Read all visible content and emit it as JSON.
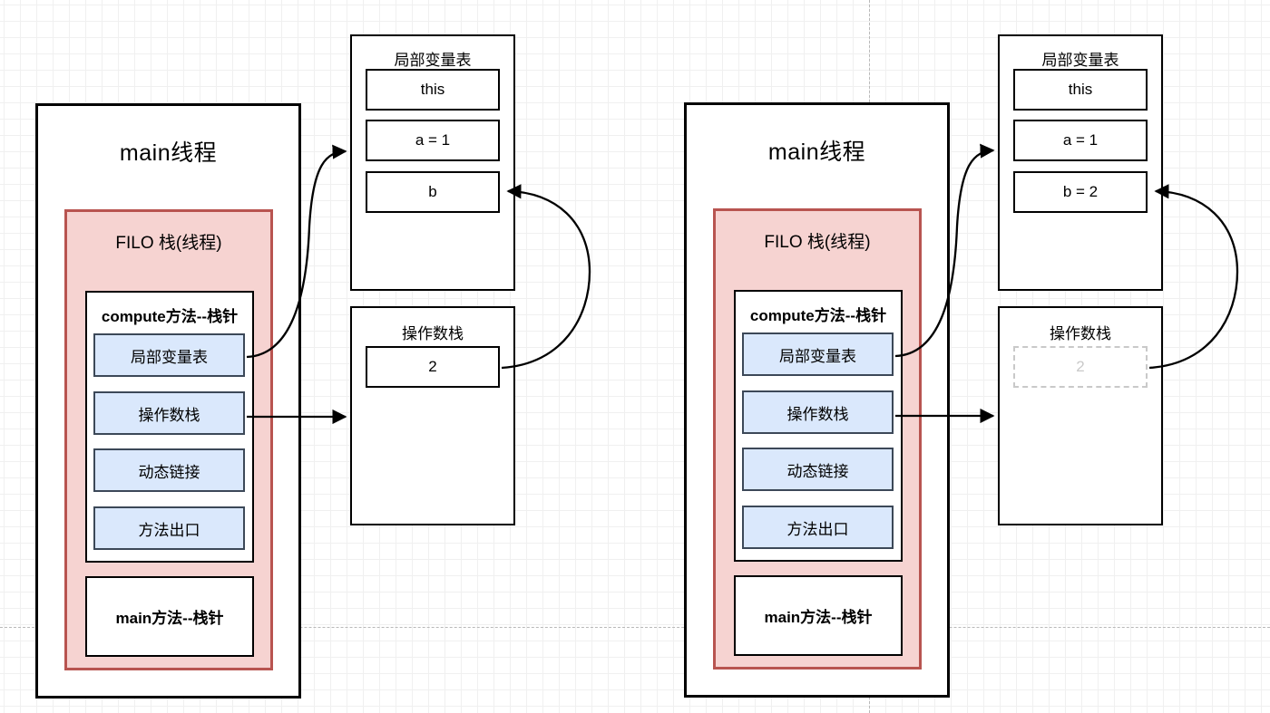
{
  "diagram": {
    "title_left": "main线程",
    "title_right": "main线程",
    "panels": [
      {
        "id": "left",
        "thread_title": "main线程",
        "filo_title": "FILO  栈(线程)",
        "frames": [
          {
            "title": "compute方法--栈针",
            "slots": [
              "局部变量表",
              "操作数栈",
              "动态链接",
              "方法出口"
            ]
          },
          {
            "title": "main方法--栈针",
            "slots": []
          }
        ],
        "local_var_table": {
          "title": "局部变量表",
          "entries": [
            {
              "label": "this",
              "state": "solid"
            },
            {
              "label": "a = 1",
              "state": "solid"
            },
            {
              "label": "b",
              "state": "solid"
            }
          ]
        },
        "operand_stack": {
          "title": "操作数栈",
          "entries": [
            {
              "label": "2",
              "state": "solid"
            }
          ]
        }
      },
      {
        "id": "right",
        "thread_title": "main线程",
        "filo_title": "FILO  栈(线程)",
        "frames": [
          {
            "title": "compute方法--栈针",
            "slots": [
              "局部变量表",
              "操作数栈",
              "动态链接",
              "方法出口"
            ]
          },
          {
            "title": "main方法--栈针",
            "slots": []
          }
        ],
        "local_var_table": {
          "title": "局部变量表",
          "entries": [
            {
              "label": "this",
              "state": "solid"
            },
            {
              "label": "a = 1",
              "state": "solid"
            },
            {
              "label": "b = 2",
              "state": "solid"
            }
          ]
        },
        "operand_stack": {
          "title": "操作数栈",
          "entries": [
            {
              "label": "2",
              "state": "ghost"
            }
          ]
        }
      }
    ],
    "colors": {
      "filo_fill": "#f6d3d1",
      "filo_border": "#b85450",
      "slot_fill": "#dae8fc",
      "slot_border": "#3c4858",
      "outline": "#000000",
      "ghost": "#c9c9c9",
      "grid_minor": "#f0f0f0",
      "grid_major": "#e2e2e2"
    }
  }
}
